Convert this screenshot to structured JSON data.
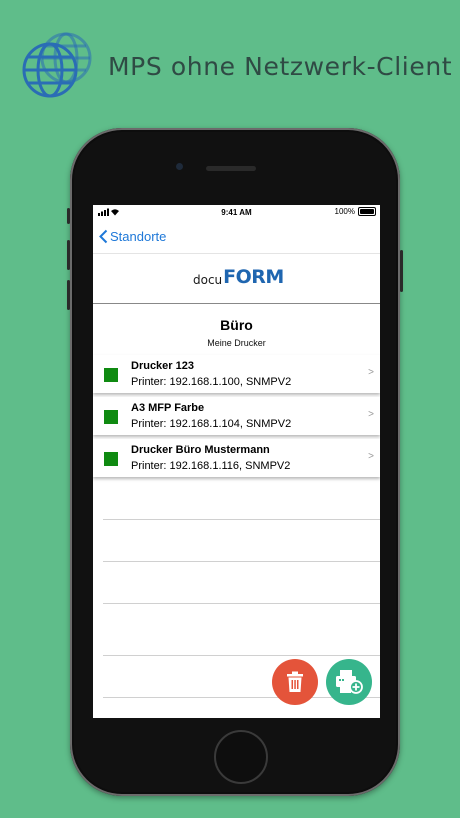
{
  "banner": {
    "title": "MPS ohne Netzwerk-Client",
    "icon": "globe-icon"
  },
  "statusbar": {
    "time": "9:41 AM",
    "battery": "100%"
  },
  "nav": {
    "back_label": "Standorte"
  },
  "logo": {
    "prefix": "docu",
    "main": "FORM"
  },
  "location": {
    "title": "Büro",
    "subtitle": "Meine Drucker"
  },
  "printers": [
    {
      "name": "Drucker 123",
      "info": "Printer: 192.168.1.100, SNMPV2",
      "status_color": "#0f8a11"
    },
    {
      "name": "A3 MFP Farbe",
      "info": "Printer: 192.168.1.104, SNMPV2",
      "status_color": "#0f8a11"
    },
    {
      "name": "Drucker Büro Mustermann",
      "info": "Printer: 192.168.1.116, SNMPV2",
      "status_color": "#0f8a11"
    }
  ],
  "chevron": ">",
  "colors": {
    "background": "#5fbd8a",
    "accent": "#1e78d8",
    "delete": "#e4543a",
    "add": "#36b58c",
    "status_ok": "#0f8a11"
  }
}
